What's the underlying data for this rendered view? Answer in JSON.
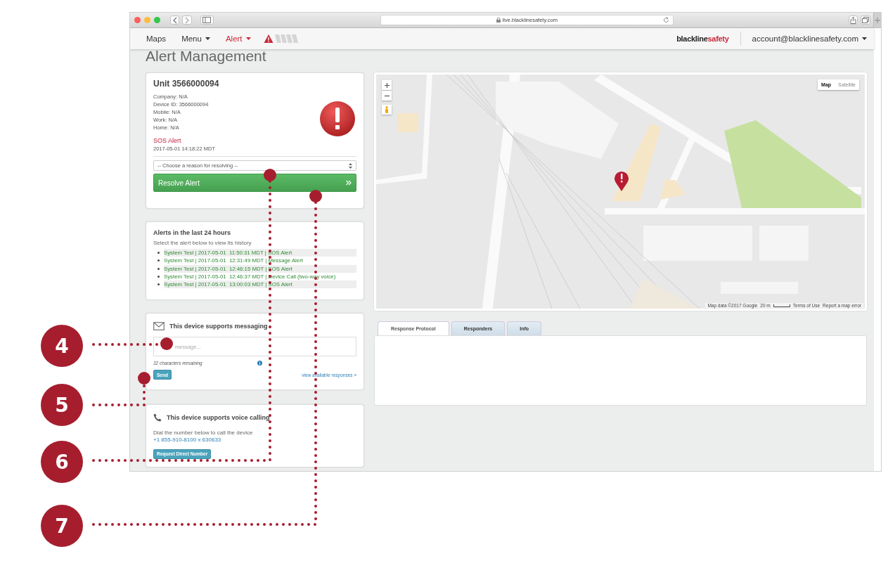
{
  "browser": {
    "url": "live.blacklinesafety.com"
  },
  "nav": {
    "items": [
      {
        "label": "Maps",
        "kind": "link"
      },
      {
        "label": "Menu",
        "kind": "dropdown"
      },
      {
        "label": "Alert",
        "kind": "alert"
      }
    ],
    "brand": {
      "dark": "blackline",
      "accent": "safety"
    },
    "account": "account@blacklinesafety.com"
  },
  "page_title": "Alert Management",
  "unit": {
    "title": "Unit 3566000094",
    "details": [
      "Company: N/A",
      "Device ID: 3566000094",
      "Mobile: N/A",
      "Work: N/A",
      "Home: N/A"
    ],
    "alert_type": "SOS Alert",
    "alert_time": "2017-05-01 14:18:22 MDT",
    "reason_select": "-- Choose a reason for resolving --",
    "resolve_button": "Resolve Alert"
  },
  "history": {
    "title": "Alerts in the last 24 hours",
    "hint": "Select the alert below to view its history",
    "alerts": [
      "System Test | 2017-05-01  11:50:31 MDT | SOS Alert",
      "System Test | 2017-05-01  12:31:49 MDT | Message Alert",
      "System Test | 2017-05-01  12:46:15 MDT | SOS Alert",
      "System Test | 2017-05-01  12:46:37 MDT | Device Call (two-way voice)",
      "System Test | 2017-05-01  13:00:03 MDT | SOS Alert"
    ]
  },
  "messaging": {
    "title": "This device supports messaging",
    "placeholder": "message...",
    "remaining": "32 characters remaining",
    "send_button": "Send",
    "responses_link": "view available responses »"
  },
  "voice": {
    "title": "This device supports voice calling",
    "hint": "Dial the number below to call the device",
    "number": "+1 855-910-8100 x 630633",
    "button": "Request Direct Number"
  },
  "map": {
    "kind": "picture",
    "type_toggle": [
      {
        "label": "Map",
        "selected": true
      },
      {
        "label": "Satellite",
        "selected": false
      }
    ],
    "attribution": [
      "Map data ©2017 Google",
      "20 m",
      "Terms of Use",
      "Report a map error"
    ]
  },
  "tabs": [
    {
      "label": "Response Protocol",
      "selected": true
    },
    {
      "label": "Responders",
      "selected": false
    },
    {
      "label": "Info",
      "selected": false
    }
  ],
  "callouts": [
    {
      "number": "4"
    },
    {
      "number": "5"
    },
    {
      "number": "6"
    },
    {
      "number": "7"
    }
  ]
}
